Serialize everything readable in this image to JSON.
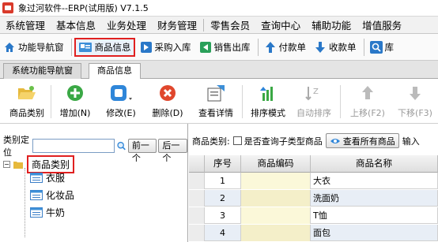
{
  "window": {
    "title": "象过河软件--ERP(试用版) V7.1.5"
  },
  "menu": [
    "系统管理",
    "基本信息",
    "业务处理",
    "财务管理",
    "零售会员",
    "查询中心",
    "辅助功能",
    "增值服务"
  ],
  "nav": {
    "items": [
      {
        "label": "功能导航窗",
        "icon": "home-icon"
      },
      {
        "label": "商品信息",
        "icon": "product-info-icon",
        "active": true
      },
      {
        "label": "采购入库",
        "icon": "purchase-in-icon"
      },
      {
        "label": "销售出库",
        "icon": "sales-out-icon"
      },
      {
        "label": "付款单",
        "icon": "payment-icon"
      },
      {
        "label": "收款单",
        "icon": "receipt-icon"
      },
      {
        "label": "库",
        "icon": "search-icon"
      }
    ]
  },
  "tabs": [
    "系统功能导航窗",
    "商品信息"
  ],
  "toolbar": {
    "category": "商品类别",
    "add": "增加(N)",
    "edit": "修改(E)",
    "delete": "删除(D)",
    "details": "查看详情",
    "sort_mode": "排序模式",
    "auto_sort": "自动排序",
    "move_up": "上移(F2)",
    "move_down": "下移(F3)"
  },
  "left": {
    "locate_label": "类别定位",
    "locate_value": "",
    "prev": "前一个",
    "next": "后一个",
    "tree_root": "商品类别",
    "tree_items": [
      "衣服",
      "化妆品",
      "牛奶"
    ]
  },
  "right": {
    "filter_label": "商品类别:",
    "subcat_checkbox": "是否查询子类型商品",
    "view_all": "查看所有商品",
    "input_label": "输入",
    "columns": [
      "序号",
      "商品编码",
      "商品名称"
    ],
    "rows": [
      {
        "no": "1",
        "code": "",
        "name": "大衣"
      },
      {
        "no": "2",
        "code": "",
        "name": "洗面奶"
      },
      {
        "no": "3",
        "code": "",
        "name": "T恤"
      },
      {
        "no": "4",
        "code": "",
        "name": "面包"
      }
    ]
  }
}
